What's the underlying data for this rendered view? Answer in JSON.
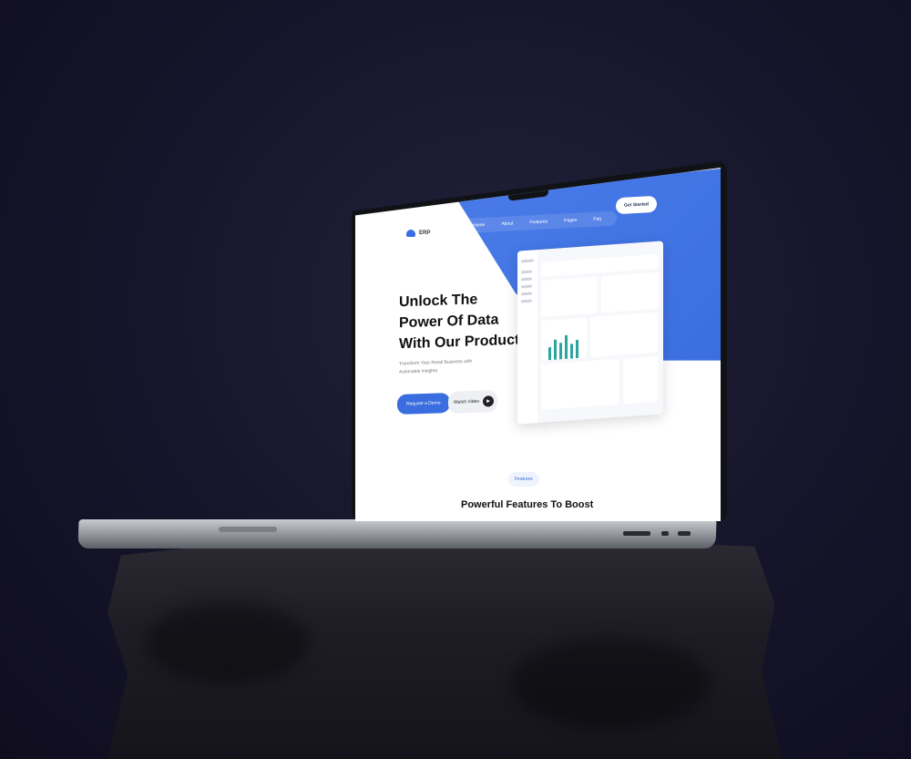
{
  "brand": {
    "name": "ERP"
  },
  "nav": {
    "items": [
      "Home",
      "About",
      "Features",
      "Pages",
      "Faq"
    ]
  },
  "cta": {
    "get_started": "Get Started"
  },
  "hero": {
    "title_lines": [
      "Unlock The",
      "Power Of Data",
      "With Our Product"
    ],
    "subtitle": "Transform Your Retail Business with Actionable Insights.",
    "demo_button": "Request a Demo",
    "watch_button": "Watch Video"
  },
  "features": {
    "pill": "Features",
    "title": "Powerful Features To Boost"
  },
  "colors": {
    "accent": "#3a6ee0",
    "background": "#16142a"
  }
}
